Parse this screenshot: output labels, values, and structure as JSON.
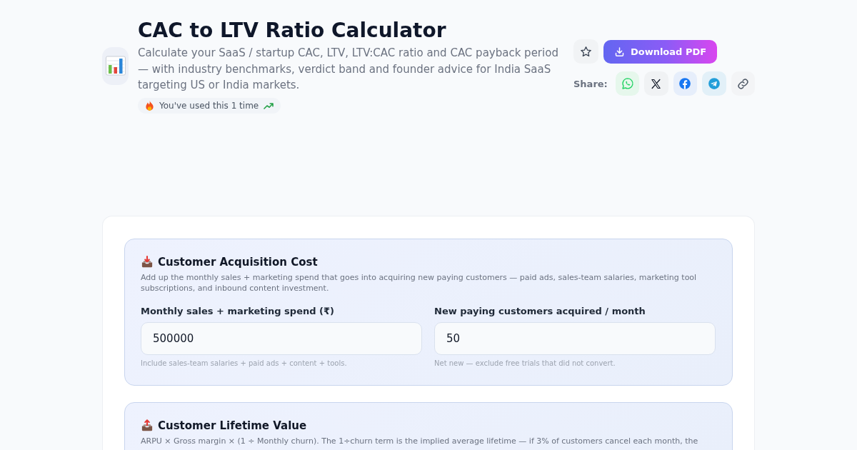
{
  "header": {
    "title": "CAC to LTV Ratio Calculator",
    "subtitle": "Calculate your SaaS / startup CAC, LTV, LTV:CAC ratio and CAC payback period — with industry benchmarks, verdict band and founder advice for India SaaS targeting US or India markets.",
    "usage_badge": "You've used this 1 time"
  },
  "actions": {
    "download_button": "Download PDF",
    "share_label": "Share:"
  },
  "sections": [
    {
      "title": "Customer Acquisition Cost",
      "description": "Add up the monthly sales + marketing spend that goes into acquiring new paying customers — paid ads, sales-team salaries, marketing tool subscriptions, and inbound content investment.",
      "fields": [
        {
          "label": "Monthly sales + marketing spend (₹)",
          "value": "500000",
          "hint": "Include sales-team salaries + paid ads + content + tools."
        },
        {
          "label": "New paying customers acquired / month",
          "value": "50",
          "hint": "Net new — exclude free trials that did not convert."
        }
      ]
    },
    {
      "title": "Customer Lifetime Value",
      "description": "ARPU × Gross margin × (1 ÷ Monthly churn). The 1÷churn term is the implied average lifetime — if 3% of customers cancel each month, the"
    }
  ]
}
